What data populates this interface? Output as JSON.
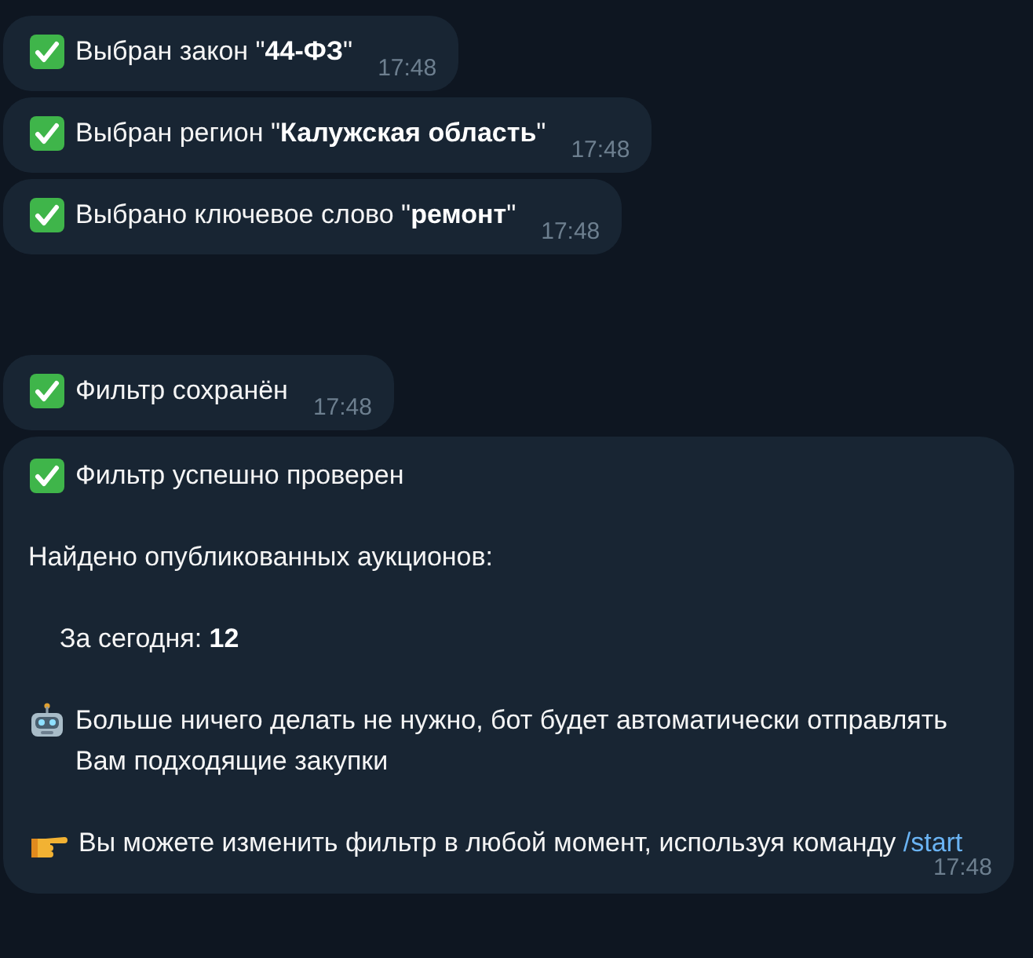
{
  "groups": [
    [
      {
        "kind": "status",
        "text": "Выбран закон \"**44-ФЗ**\"",
        "time": "17:48"
      },
      {
        "kind": "status",
        "text": "Выбран регион \"**Калужская область**\"",
        "time": "17:48"
      },
      {
        "kind": "status",
        "text": "Выбрано ключевое слово \"**ремонт**\"",
        "time": "17:48"
      }
    ],
    [
      {
        "kind": "status",
        "text": "Фильтр сохранён",
        "time": "17:48"
      },
      {
        "kind": "report",
        "time": "17:48",
        "paragraphs": [
          {
            "kind": "check",
            "text": "Фильтр успешно проверен"
          },
          {
            "kind": "plain",
            "text": "Найдено опубликованных аукционов:"
          },
          {
            "kind": "indent",
            "text": "За сегодня: **12**"
          },
          {
            "kind": "robot",
            "text": "Больше ничего делать не нужно, бот будет автоматически отправлять Вам подходящие закупки"
          },
          {
            "kind": "pointer",
            "text": "Вы можете изменить фильтр в любой момент, используя команду",
            "command": "/start"
          }
        ]
      }
    ]
  ]
}
